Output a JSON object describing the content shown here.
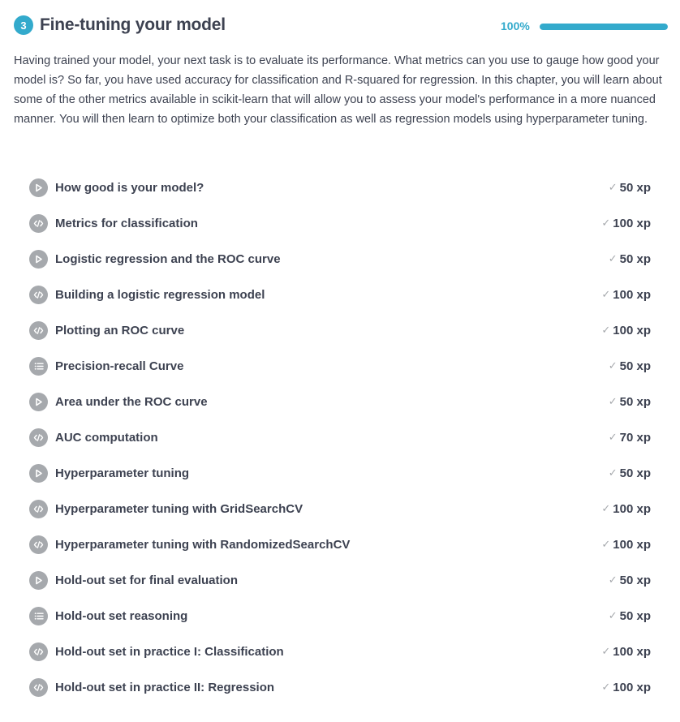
{
  "chapter": {
    "number": "3",
    "title": "Fine-tuning your model",
    "progress_label": "100%",
    "progress_value": 1.0,
    "accent_color": "#33aacc",
    "description": "Having trained your model, your next task is to evaluate its performance. What metrics can you use to gauge how good your model is? So far, you have used accuracy for classification and R-squared for regression. In this chapter, you will learn about some of the other metrics available in scikit-learn that will allow you to assess your model's performance in a more nuanced manner. You will then learn to optimize both your classification as well as regression models using hyperparameter tuning."
  },
  "exercises": [
    {
      "title": "How good is your model?",
      "xp": "50 xp",
      "icon": "play-icon",
      "completed": true
    },
    {
      "title": "Metrics for classification",
      "xp": "100 xp",
      "icon": "code-icon",
      "completed": true
    },
    {
      "title": "Logistic regression and the ROC curve",
      "xp": "50 xp",
      "icon": "play-icon",
      "completed": true
    },
    {
      "title": "Building a logistic regression model",
      "xp": "100 xp",
      "icon": "code-icon",
      "completed": true
    },
    {
      "title": "Plotting an ROC curve",
      "xp": "100 xp",
      "icon": "code-icon",
      "completed": true
    },
    {
      "title": "Precision-recall Curve",
      "xp": "50 xp",
      "icon": "list-icon",
      "completed": true
    },
    {
      "title": "Area under the ROC curve",
      "xp": "50 xp",
      "icon": "play-icon",
      "completed": true
    },
    {
      "title": "AUC computation",
      "xp": "70 xp",
      "icon": "code-icon",
      "completed": true
    },
    {
      "title": "Hyperparameter tuning",
      "xp": "50 xp",
      "icon": "play-icon",
      "completed": true
    },
    {
      "title": "Hyperparameter tuning with GridSearchCV",
      "xp": "100 xp",
      "icon": "code-icon",
      "completed": true
    },
    {
      "title": "Hyperparameter tuning with RandomizedSearchCV",
      "xp": "100 xp",
      "icon": "code-icon",
      "completed": true
    },
    {
      "title": "Hold-out set for final evaluation",
      "xp": "50 xp",
      "icon": "play-icon",
      "completed": true
    },
    {
      "title": "Hold-out set reasoning",
      "xp": "50 xp",
      "icon": "list-icon",
      "completed": true
    },
    {
      "title": "Hold-out set in practice I: Classification",
      "xp": "100 xp",
      "icon": "code-icon",
      "completed": true
    },
    {
      "title": "Hold-out set in practice II: Regression",
      "xp": "100 xp",
      "icon": "code-icon",
      "completed": true
    }
  ]
}
